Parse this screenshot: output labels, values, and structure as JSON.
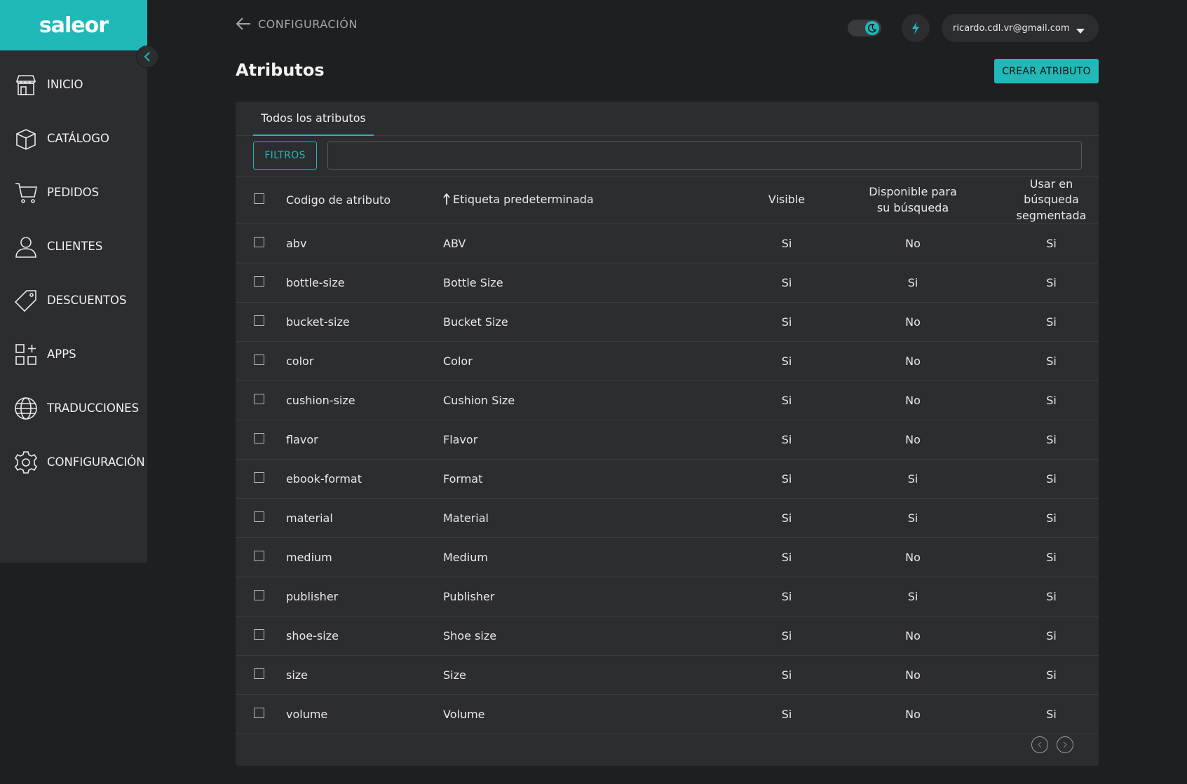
{
  "sidebar": {
    "logo": "saleor",
    "items": [
      {
        "label": "INICIO"
      },
      {
        "label": "CATÁLOGO"
      },
      {
        "label": "PEDIDOS"
      },
      {
        "label": "CLIENTES"
      },
      {
        "label": "DESCUENTOS"
      },
      {
        "label": "APPS"
      },
      {
        "label": "TRADUCCIONES"
      },
      {
        "label": "CONFIGURACIÓN"
      }
    ]
  },
  "header": {
    "back_label": "CONFIGURACIÓN",
    "user_email": "ricardo.cdl.vr@gmail.com"
  },
  "page": {
    "title": "Atributos",
    "create_label": "CREAR ATRIBUTO"
  },
  "tabs": [
    {
      "label": "Todos los atributos"
    }
  ],
  "filters": {
    "button_label": "FILTROS",
    "search_value": ""
  },
  "table": {
    "headers": {
      "code": "Codigo de atributo",
      "label": "Etiqueta predeterminada",
      "visible": "Visible",
      "searchable": "Disponible para su búsqueda",
      "faceted": "Usar en búsqueda segmentada"
    },
    "rows": [
      {
        "code": "abv",
        "label": "ABV",
        "visible": "Si",
        "searchable": "No",
        "faceted": "Si"
      },
      {
        "code": "bottle-size",
        "label": "Bottle Size",
        "visible": "Si",
        "searchable": "Si",
        "faceted": "Si"
      },
      {
        "code": "bucket-size",
        "label": "Bucket Size",
        "visible": "Si",
        "searchable": "No",
        "faceted": "Si"
      },
      {
        "code": "color",
        "label": "Color",
        "visible": "Si",
        "searchable": "No",
        "faceted": "Si"
      },
      {
        "code": "cushion-size",
        "label": "Cushion Size",
        "visible": "Si",
        "searchable": "No",
        "faceted": "Si"
      },
      {
        "code": "flavor",
        "label": "Flavor",
        "visible": "Si",
        "searchable": "No",
        "faceted": "Si"
      },
      {
        "code": "ebook-format",
        "label": "Format",
        "visible": "Si",
        "searchable": "Si",
        "faceted": "Si"
      },
      {
        "code": "material",
        "label": "Material",
        "visible": "Si",
        "searchable": "Si",
        "faceted": "Si"
      },
      {
        "code": "medium",
        "label": "Medium",
        "visible": "Si",
        "searchable": "No",
        "faceted": "Si"
      },
      {
        "code": "publisher",
        "label": "Publisher",
        "visible": "Si",
        "searchable": "Si",
        "faceted": "Si"
      },
      {
        "code": "shoe-size",
        "label": "Shoe size",
        "visible": "Si",
        "searchable": "No",
        "faceted": "Si"
      },
      {
        "code": "size",
        "label": "Size",
        "visible": "Si",
        "searchable": "No",
        "faceted": "Si"
      },
      {
        "code": "volume",
        "label": "Volume",
        "visible": "Si",
        "searchable": "No",
        "faceted": "Si"
      }
    ]
  },
  "colors": {
    "accent": "#21b8b8",
    "background": "#1e1f21",
    "surface": "#2c2d30"
  }
}
